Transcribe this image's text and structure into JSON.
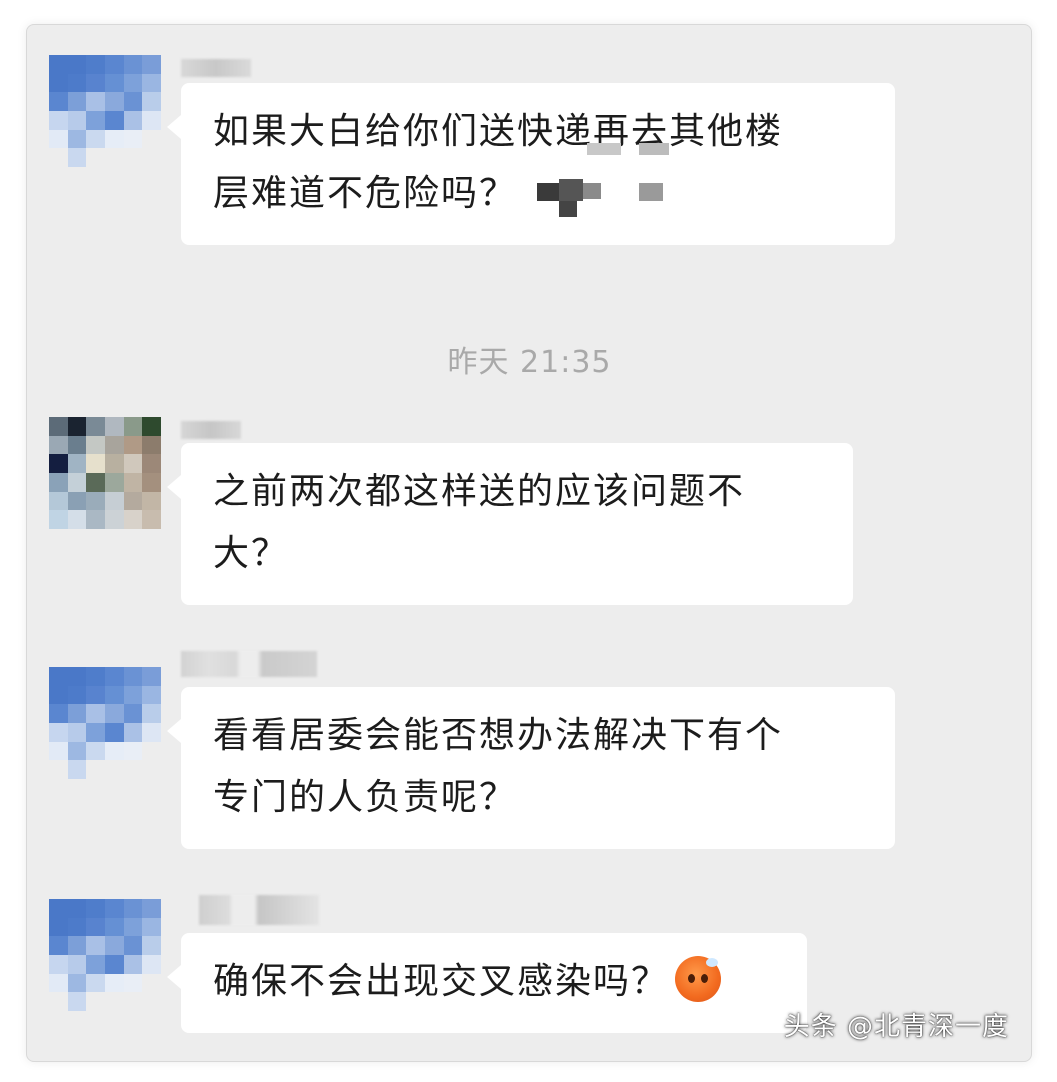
{
  "timestamp": "昨天 21:35",
  "messages": [
    {
      "avatar": "blue-pixel-avatar",
      "lines": [
        "如果大白给你们送快递再去其他楼",
        "层难道不危险吗？"
      ]
    },
    {
      "avatar": "multicolor-pixel-avatar",
      "lines": [
        "之前两次都这样送的应该问题不",
        "大？"
      ]
    },
    {
      "avatar": "blue-pixel-avatar",
      "lines": [
        "看看居委会能否想办法解决下有个",
        "专门的人负责呢？"
      ]
    },
    {
      "avatar": "blue-pixel-avatar",
      "lines": [
        "确保不会出现交叉感染吗？"
      ],
      "emoji": "sweat-face-emoji"
    }
  ],
  "watermark": "头条 @北青深一度",
  "colors": {
    "background": "#ededed",
    "bubble": "#ffffff",
    "text": "#1c1c1c",
    "timestamp": "#a9a9a9"
  }
}
